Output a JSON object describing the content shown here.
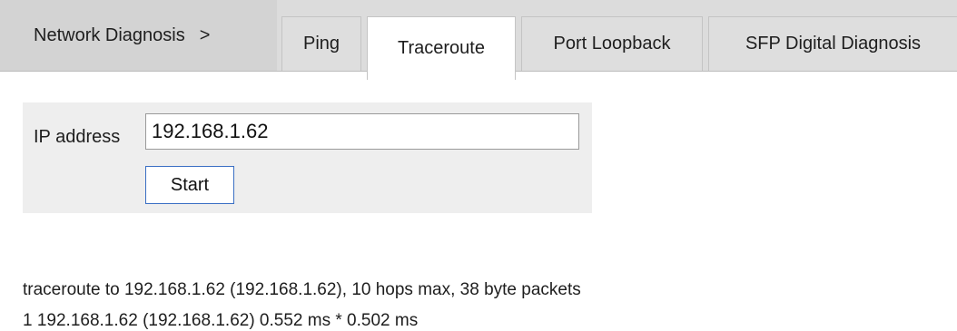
{
  "nav": {
    "breadcrumb": "Network Diagnosis",
    "breadcrumb_separator": ">",
    "tabs": [
      {
        "label": "Ping",
        "active": false
      },
      {
        "label": "Traceroute",
        "active": true
      },
      {
        "label": "Port Loopback",
        "active": false
      },
      {
        "label": "SFP Digital Diagnosis",
        "active": false
      }
    ]
  },
  "form": {
    "ip_label": "IP address",
    "ip_value": "192.168.1.62",
    "start_label": "Start"
  },
  "output": {
    "lines": [
      "traceroute to 192.168.1.62 (192.168.1.62), 10 hops max, 38 byte packets",
      "1 192.168.1.62 (192.168.1.62) 0.552 ms * 0.502 ms"
    ]
  },
  "colors": {
    "tabbar_bg": "#dcdcdc",
    "active_tab_bg": "#ffffff",
    "form_panel_bg": "#eeeeee",
    "button_border": "#3a6fc4"
  }
}
